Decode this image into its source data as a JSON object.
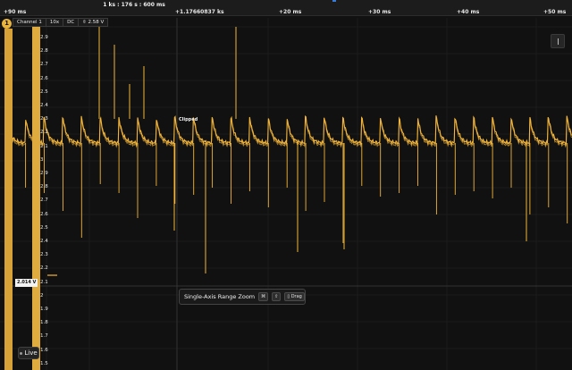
{
  "timebar": {
    "span_label": "1 ks : 176 s : 600 ms",
    "ticks": [
      {
        "label": "+90 ms"
      },
      {
        "label": "+1.17660837 ks"
      },
      {
        "label": "+20 ms"
      },
      {
        "label": "+30 ms"
      },
      {
        "label": "+40 ms"
      },
      {
        "label": "+50 ms"
      }
    ]
  },
  "channel": {
    "badge": "1",
    "name": "Channel 1",
    "probe": "10x",
    "coupling": "DC",
    "scale": "2.58 V",
    "color": "#e8b43b"
  },
  "y_axis": {
    "labels": [
      "2.9",
      "2.8",
      "2.7",
      "2.6",
      "2.5",
      "2.4",
      "2.3",
      "2.2",
      "2.1",
      "3",
      "2.9",
      "2.8",
      "2.7",
      "2.6",
      "2.5",
      "2.4",
      "2.3",
      "2.2",
      "2.1",
      "2",
      "1.9",
      "1.8",
      "1.7",
      "1.6",
      "1.5"
    ]
  },
  "trigger": {
    "level_label": "2.014 V"
  },
  "annotation": {
    "clipped": "Clipped"
  },
  "zoom_tooltip": {
    "title": "Single-Axis Range Zoom",
    "keys": [
      {
        "label": "⌘",
        "icon": "command-icon"
      },
      {
        "label": "⇧",
        "icon": "shift-icon"
      },
      {
        "label": "▯ Drag",
        "icon": "mouse-icon"
      }
    ]
  },
  "live_button": {
    "label": "Live"
  },
  "colors": {
    "background": "#111111",
    "waveform": "#f2b53a",
    "accent_blue": "#3a7bd5"
  }
}
